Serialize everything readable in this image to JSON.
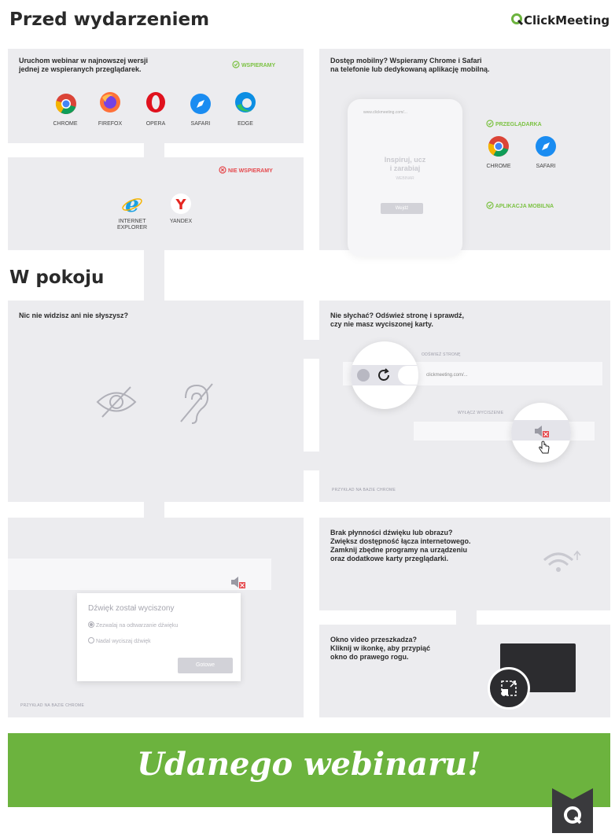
{
  "header": {
    "title_before": "Przed wydarzeniem",
    "brand": "ClickMeeting",
    "title_room": "W pokoju"
  },
  "supported": {
    "text": "Uruchom webinar w najnowszej wersji\njednej ze wspieranych przeglądarek.",
    "badge": "WSPIERAMY",
    "browsers": [
      "CHROME",
      "FIREFOX",
      "OPERA",
      "SAFARI",
      "EDGE"
    ]
  },
  "unsupported": {
    "badge": "NIE WSPIERAMY",
    "browsers": [
      "INTERNET\nEXPLORER",
      "YANDEX"
    ]
  },
  "mobile": {
    "text": "Dostęp mobilny? Wspieramy Chrome i Safari\nna telefonie lub dedykowaną aplikację mobilną.",
    "phone_url": "www.clickmeeting.com/...",
    "phone_tagline": "Inspiruj, ucz\ni zarabiaj",
    "phone_sub": "WEBINAR",
    "phone_button": "Wejdź",
    "browser_badge": "PRZEGLĄDARKA",
    "browsers": [
      "CHROME",
      "SAFARI"
    ],
    "app_badge": "APLIKACJA MOBILNA"
  },
  "no_av": {
    "text": "Nic nie widzisz ani nie słyszysz?"
  },
  "no_sound": {
    "text": "Nie słychać? Odśwież stronę i sprawdź,\nczy nie masz wyciszonej karty.",
    "refresh_label": "ODŚWIEŻ STRONĘ",
    "url": "clickmeeting.com/...",
    "mute_label": "WYŁĄCZ WYCISZENIE",
    "caption": "PRZYKŁAD NA BAZIE CHROME"
  },
  "dialog": {
    "title": "Dźwięk został wyciszony",
    "option1": "Zezwalaj na odtwarzanie dźwięku",
    "option2": "Nadal wyciszaj dźwięk",
    "button": "Gotowe",
    "caption": "PRZYKŁAD NA BAZIE CHROME"
  },
  "lag": {
    "text": "Brak płynności dźwięku lub obrazu?\nZwiększ dostępność łącza internetowego.\nZamknij zbędne programy na urządzeniu\noraz dodatkowe karty przeglądarki."
  },
  "video": {
    "text": "Okno video przeszkadza?\nKliknij w ikonkę, aby przypiąć\nokno do prawego rogu."
  },
  "banner": {
    "text": "Udanego webinaru!",
    "color": "#6cb33e"
  }
}
